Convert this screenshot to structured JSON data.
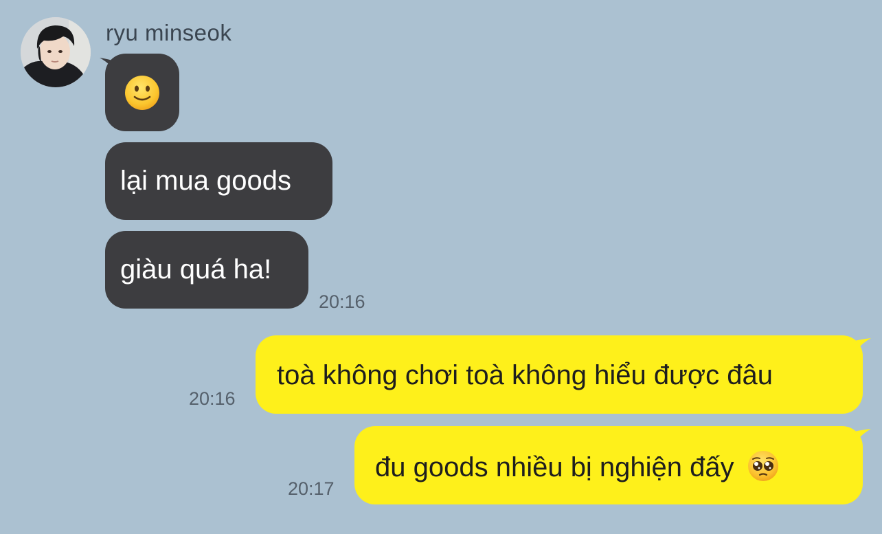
{
  "conversation": {
    "sender": {
      "name": "ryu minseok",
      "avatar_icon": "profile-photo"
    },
    "incoming": [
      {
        "type": "emoji",
        "icon": "slightly-smiling-face-emoji",
        "text": ""
      },
      {
        "type": "text",
        "text": "lại mua goods"
      },
      {
        "type": "text",
        "text": "giàu quá ha!"
      }
    ],
    "incoming_time": "20:16",
    "outgoing": [
      {
        "text": "toà không chơi toà không hiểu được đâu",
        "time": "20:16"
      },
      {
        "text": "đu goods nhiều bị nghiện đấy",
        "emoji": "pleading-face-emoji",
        "time": "20:17"
      }
    ]
  },
  "colors": {
    "background": "#abc1d1",
    "incoming_bubble": "#3d3d40",
    "outgoing_bubble": "#fef01b",
    "timestamp": "#55606b"
  }
}
